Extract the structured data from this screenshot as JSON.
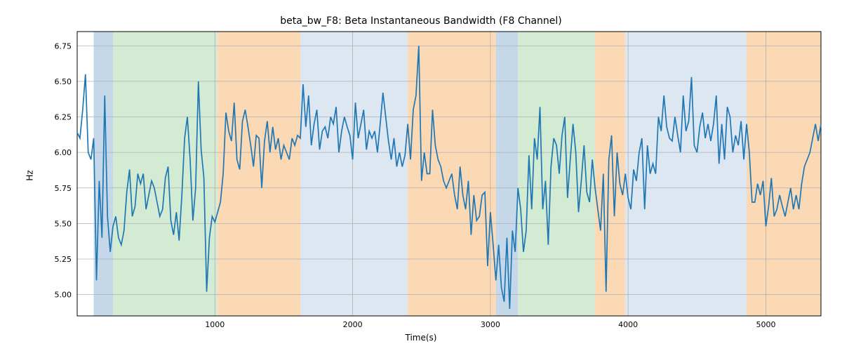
{
  "chart_data": {
    "type": "line",
    "title": "beta_bw_F8: Beta Instantaneous Bandwidth (F8 Channel)",
    "xlabel": "Time(s)",
    "ylabel": "Hz",
    "xlim": [
      0,
      5400
    ],
    "ylim": [
      4.85,
      6.85
    ],
    "xticks": [
      1000,
      2000,
      3000,
      4000,
      5000
    ],
    "yticks": [
      5.0,
      5.25,
      5.5,
      5.75,
      6.0,
      6.25,
      6.5,
      6.75
    ],
    "bands": [
      {
        "x0": 120,
        "x1": 260,
        "color": "#c4d8ea"
      },
      {
        "x0": 260,
        "x1": 1020,
        "color": "#d3ebd3"
      },
      {
        "x0": 1020,
        "x1": 1620,
        "color": "#fbd9b5"
      },
      {
        "x0": 1620,
        "x1": 2400,
        "color": "#dce7f2"
      },
      {
        "x0": 2400,
        "x1": 3040,
        "color": "#fbd9b5"
      },
      {
        "x0": 3040,
        "x1": 3200,
        "color": "#c4d8ea"
      },
      {
        "x0": 3200,
        "x1": 3760,
        "color": "#d3ebd3"
      },
      {
        "x0": 3760,
        "x1": 3980,
        "color": "#fbd9b5"
      },
      {
        "x0": 3980,
        "x1": 4200,
        "color": "#dce7f2"
      },
      {
        "x0": 4200,
        "x1": 4860,
        "color": "#dce7f2"
      },
      {
        "x0": 4860,
        "x1": 5400,
        "color": "#fbd9b5"
      }
    ],
    "series": [
      {
        "name": "beta_bw_F8",
        "x": [
          0,
          20,
          40,
          60,
          80,
          100,
          120,
          140,
          160,
          180,
          200,
          220,
          240,
          260,
          280,
          300,
          320,
          340,
          360,
          380,
          400,
          420,
          440,
          460,
          480,
          500,
          520,
          540,
          560,
          580,
          600,
          620,
          640,
          660,
          680,
          700,
          720,
          740,
          760,
          780,
          800,
          820,
          840,
          860,
          880,
          900,
          920,
          940,
          960,
          980,
          1000,
          1020,
          1040,
          1060,
          1080,
          1100,
          1120,
          1140,
          1160,
          1180,
          1200,
          1220,
          1240,
          1260,
          1280,
          1300,
          1320,
          1340,
          1360,
          1380,
          1400,
          1420,
          1440,
          1460,
          1480,
          1500,
          1520,
          1540,
          1560,
          1580,
          1600,
          1620,
          1640,
          1660,
          1680,
          1700,
          1720,
          1740,
          1760,
          1780,
          1800,
          1820,
          1840,
          1860,
          1880,
          1900,
          1920,
          1940,
          1960,
          1980,
          2000,
          2020,
          2040,
          2060,
          2080,
          2100,
          2120,
          2140,
          2160,
          2180,
          2200,
          2220,
          2240,
          2260,
          2280,
          2300,
          2320,
          2340,
          2360,
          2380,
          2400,
          2420,
          2440,
          2460,
          2480,
          2500,
          2520,
          2540,
          2560,
          2580,
          2600,
          2620,
          2640,
          2660,
          2680,
          2700,
          2720,
          2740,
          2760,
          2780,
          2800,
          2820,
          2840,
          2860,
          2880,
          2900,
          2920,
          2940,
          2960,
          2980,
          3000,
          3020,
          3040,
          3060,
          3080,
          3100,
          3120,
          3140,
          3160,
          3180,
          3200,
          3220,
          3240,
          3260,
          3280,
          3300,
          3320,
          3340,
          3360,
          3380,
          3400,
          3420,
          3440,
          3460,
          3480,
          3500,
          3520,
          3540,
          3560,
          3580,
          3600,
          3620,
          3640,
          3660,
          3680,
          3700,
          3720,
          3740,
          3760,
          3780,
          3800,
          3820,
          3840,
          3860,
          3880,
          3900,
          3920,
          3940,
          3960,
          3980,
          4000,
          4020,
          4040,
          4060,
          4080,
          4100,
          4120,
          4140,
          4160,
          4180,
          4200,
          4220,
          4240,
          4260,
          4280,
          4300,
          4320,
          4340,
          4360,
          4380,
          4400,
          4420,
          4440,
          4460,
          4480,
          4500,
          4520,
          4540,
          4560,
          4580,
          4600,
          4620,
          4640,
          4660,
          4680,
          4700,
          4720,
          4740,
          4760,
          4780,
          4800,
          4820,
          4840,
          4860,
          4880,
          4900,
          4920,
          4940,
          4960,
          4980,
          5000,
          5020,
          5040,
          5060,
          5080,
          5100,
          5120,
          5140,
          5160,
          5180,
          5200,
          5220,
          5240,
          5260,
          5280,
          5300,
          5320,
          5340,
          5360,
          5380,
          5400
        ],
        "y": [
          6.14,
          6.1,
          6.3,
          6.55,
          6.0,
          5.95,
          6.1,
          5.1,
          5.8,
          5.4,
          6.4,
          5.55,
          5.3,
          5.48,
          5.55,
          5.4,
          5.35,
          5.45,
          5.72,
          5.88,
          5.55,
          5.62,
          5.85,
          5.78,
          5.85,
          5.6,
          5.7,
          5.8,
          5.75,
          5.65,
          5.55,
          5.6,
          5.82,
          5.9,
          5.52,
          5.42,
          5.58,
          5.38,
          5.7,
          6.1,
          6.25,
          5.95,
          5.52,
          5.75,
          6.5,
          6.02,
          5.82,
          5.02,
          5.4,
          5.55,
          5.51,
          5.58,
          5.65,
          5.85,
          6.28,
          6.15,
          6.08,
          6.35,
          5.95,
          5.88,
          6.22,
          6.3,
          6.18,
          6.05,
          5.9,
          6.12,
          6.1,
          5.75,
          6.08,
          6.22,
          6.0,
          6.18,
          6.02,
          6.1,
          5.95,
          6.05,
          6.0,
          5.95,
          6.1,
          6.05,
          6.12,
          6.1,
          6.48,
          6.18,
          6.4,
          6.05,
          6.2,
          6.3,
          6.02,
          6.15,
          6.18,
          6.1,
          6.25,
          6.2,
          6.32,
          6.0,
          6.15,
          6.25,
          6.18,
          6.12,
          5.95,
          6.35,
          6.1,
          6.2,
          6.3,
          6.02,
          6.15,
          6.1,
          6.15,
          6.0,
          6.2,
          6.42,
          6.25,
          6.08,
          5.95,
          6.1,
          5.9,
          6.0,
          5.9,
          5.98,
          6.2,
          5.95,
          6.3,
          6.4,
          6.75,
          5.8,
          6.0,
          5.85,
          5.85,
          6.3,
          6.05,
          5.95,
          5.9,
          5.8,
          5.75,
          5.8,
          5.85,
          5.7,
          5.6,
          5.9,
          5.7,
          5.6,
          5.8,
          5.42,
          5.7,
          5.52,
          5.55,
          5.7,
          5.72,
          5.2,
          5.58,
          5.35,
          5.1,
          5.35,
          5.05,
          4.95,
          5.4,
          4.9,
          5.45,
          5.3,
          5.75,
          5.6,
          5.3,
          5.45,
          5.98,
          5.6,
          6.1,
          5.95,
          6.32,
          5.6,
          5.8,
          5.35,
          5.9,
          6.1,
          6.05,
          5.85,
          6.12,
          6.25,
          5.68,
          5.95,
          6.2,
          6.0,
          5.58,
          5.8,
          6.05,
          5.72,
          5.65,
          5.95,
          5.75,
          5.6,
          5.45,
          5.85,
          5.02,
          5.95,
          6.12,
          5.55,
          6.0,
          5.78,
          5.7,
          5.85,
          5.68,
          5.6,
          5.88,
          5.8,
          6.0,
          6.1,
          5.6,
          6.05,
          5.85,
          5.92,
          5.85,
          6.25,
          6.15,
          6.4,
          6.18,
          6.1,
          6.08,
          6.25,
          6.12,
          6.0,
          6.4,
          6.15,
          6.22,
          6.53,
          6.05,
          6.0,
          6.18,
          6.28,
          6.1,
          6.2,
          6.08,
          6.2,
          6.4,
          5.92,
          6.2,
          5.95,
          6.32,
          6.25,
          6.0,
          6.12,
          6.05,
          6.22,
          5.95,
          6.2,
          6.0,
          5.65,
          5.65,
          5.78,
          5.7,
          5.8,
          5.48,
          5.62,
          5.82,
          5.55,
          5.6,
          5.7,
          5.62,
          5.55,
          5.65,
          5.75,
          5.6,
          5.7,
          5.6,
          5.78,
          5.9,
          5.95,
          6.0,
          6.1,
          6.2,
          6.08,
          6.2
        ]
      }
    ]
  }
}
